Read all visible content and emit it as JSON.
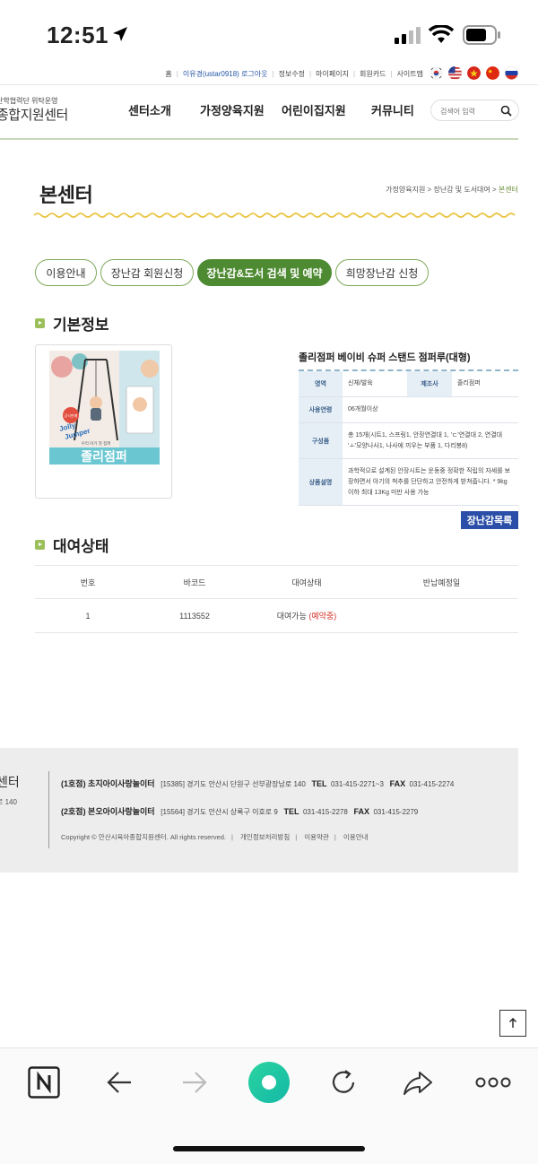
{
  "status_bar": {
    "time": "12:51"
  },
  "util_bar": {
    "links": [
      "홈",
      "이유경(ustar0918) 로그아웃",
      "정보수정",
      "마이페이지",
      "회원카드",
      "사이트맵"
    ],
    "flags": [
      "kr-flag",
      "us-flag",
      "vn-flag",
      "cn-flag",
      "ru-flag"
    ]
  },
  "header": {
    "logo_small": "산학협력단 위탁운영",
    "logo_big": "종합지원센터",
    "nav": [
      "센터소개",
      "가정양육지원",
      "어린이집지원",
      "커뮤니티"
    ],
    "search_placeholder": "검색어 입력"
  },
  "page": {
    "title": "본센터",
    "breadcrumb": [
      "가정양육지원",
      "장난감 및 도서대여",
      "본센터"
    ]
  },
  "tabs": [
    {
      "label": "이용안내",
      "active": false
    },
    {
      "label": "장난감 회원신청",
      "active": false
    },
    {
      "label": "장난감&도서 검색 및 예약",
      "active": true
    },
    {
      "label": "희망장난감 신청",
      "active": false
    }
  ],
  "basic_info": {
    "heading": "기본정보",
    "product_name": "졸리점퍼 베이비 슈퍼 스탠드 점퍼루(대형)",
    "image_text": {
      "brand1": "Jolly",
      "brand2": "Jumper",
      "main": "졸리점퍼",
      "sub": "우리 아기 첫 점퍼",
      "badge": "공식판매"
    },
    "rows": {
      "area_label": "영역",
      "area_value": "신체/발육",
      "maker_label": "제조사",
      "maker_value": "졸리점퍼",
      "age_label": "사용연령",
      "age_value": "06개월이상",
      "parts_label": "구성품",
      "parts_value": "총 15개(시트1, 스프링1, 안장연결대 1, 'ㄷ'연결대 2, 연결대 'ㅗ'모양나사1, 나사에 끼우는 부품 1, 다리봉8)",
      "desc_label": "상품설명",
      "desc_value": "과학적으로 설계된 안장시트는 운동중 정확한 직립의 자세를 보장하면서 아기의 척추를 단단하고 안전하게 받쳐줍니다. * 9kg 이하 최대 13Kg 미만 사용 가능"
    },
    "list_button": "장난감목록"
  },
  "rental": {
    "heading": "대여상태",
    "headers": [
      "번호",
      "바코드",
      "대여상태",
      "반납예정일"
    ],
    "rows": [
      {
        "no": "1",
        "barcode": "1113552",
        "status": "대여가능",
        "reserved": "(예약중)",
        "due": ""
      }
    ]
  },
  "footer": {
    "center_name": "센터",
    "center_addr": "로 140",
    "branch1": {
      "name": "(1호점) 초지아이사랑놀이터",
      "addr": "[15385] 경기도 안산시 단원구 선부광장남로 140",
      "tel_label": "TEL",
      "tel": "031-415-2271~3",
      "fax_label": "FAX",
      "fax": "031-415-2274"
    },
    "branch2": {
      "name": "(2호점) 본오아이사랑놀이터",
      "addr": "[15564] 경기도 안산시 상록구 이호로 9",
      "tel_label": "TEL",
      "tel": "031-415-2278",
      "fax_label": "FAX",
      "fax": "031-415-2279"
    },
    "copyright": "Copyright © 안산시육아종합지원센터. All rights reserved.",
    "links": [
      "개인정보처리방침",
      "이용약관",
      "이용안내"
    ]
  },
  "colors": {
    "accent_green": "#4e8a32",
    "button_blue": "#2b4fa8",
    "reserved_red": "#d7312a"
  }
}
